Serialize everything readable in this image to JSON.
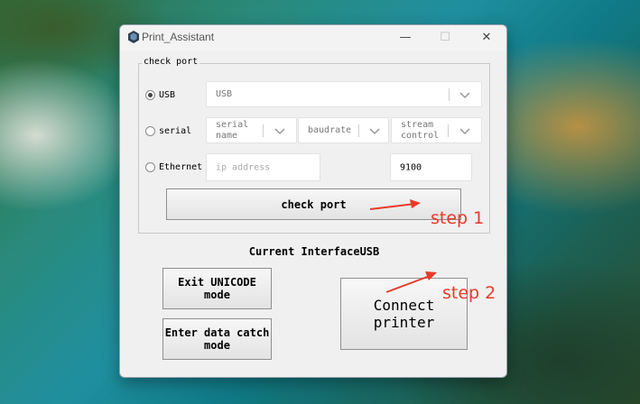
{
  "window": {
    "title": "Print_Assistant",
    "controls": {
      "minimize": "—",
      "maximize": "☐",
      "close": "✕"
    },
    "app_icon": "hexagon-app-icon"
  },
  "check_port_group": {
    "label": "check port",
    "usb": {
      "label": "USB",
      "selected": true,
      "combo_value": "USB"
    },
    "serial": {
      "label": "serial",
      "selected": false,
      "port_placeholder": "serial name",
      "baudrate_placeholder": "baudrate",
      "stream_placeholder": "stream control"
    },
    "ethernet": {
      "label": "Ethernet",
      "selected": false,
      "ip_placeholder": "ip address",
      "port_value": "9100"
    },
    "check_button": "check port"
  },
  "current_interface": "Current InterfaceUSB",
  "buttons": {
    "exit_unicode": "Exit UNICODE mode",
    "enter_data_catch": "Enter data catch mode",
    "connect_printer": "Connect printer"
  },
  "annotations": {
    "step1": "step 1",
    "step2": "step 2",
    "color": "#e83a2a"
  },
  "colors": {
    "window_bg": "#f0f0f0",
    "button_border": "#8f8f8f",
    "accent_red": "#e83a2a"
  }
}
